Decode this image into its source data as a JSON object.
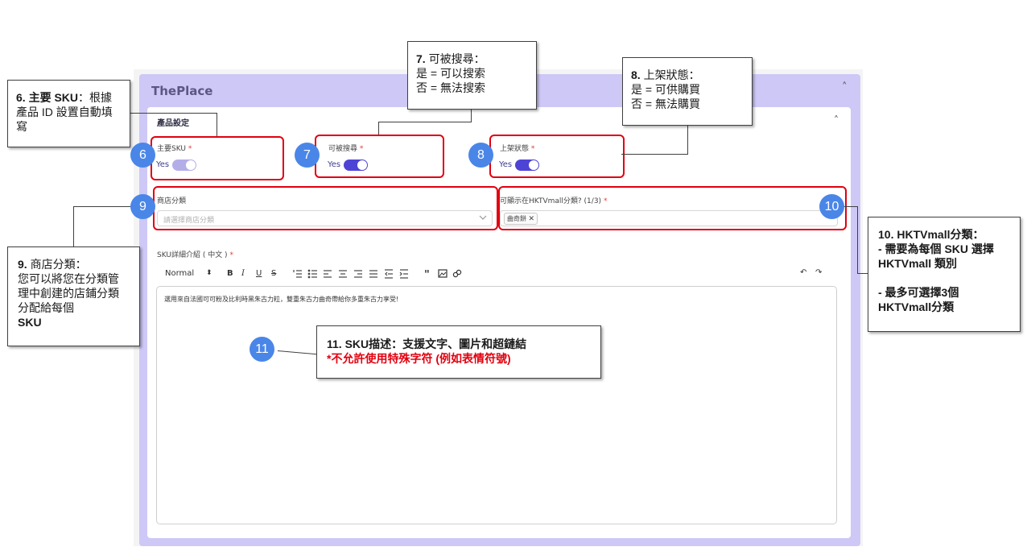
{
  "panel": {
    "title": "ThePlace",
    "chevron": "˄"
  },
  "section": {
    "title": "產品設定",
    "chevron": "˄"
  },
  "fields": {
    "main_sku": {
      "label": "主要SKU",
      "req": "*",
      "value": "Yes"
    },
    "searchable": {
      "label": "可被搜尋",
      "req": "*",
      "value": "Yes"
    },
    "online_status": {
      "label": "上架狀態",
      "req": "*",
      "value": "Yes"
    },
    "store_category": {
      "label": "商店分類",
      "placeholder": "請選擇商店分類"
    },
    "hktv_category": {
      "label": "可顯示在HKTVmall分類? (1/3)",
      "req": "*",
      "chip": "曲奇餅"
    },
    "sku_desc": {
      "label": "SKU詳細介紹 ( 中文 )",
      "req": "*",
      "content": "選用來自法國可可粉及比利時黑朱古力粒，雙重朱古力曲奇帶給你多重朱古力享受!"
    }
  },
  "toolbar": {
    "format": "Normal",
    "format_arrows": "⬍",
    "bold": "B",
    "italic": "I",
    "underline": "U",
    "strike": "S",
    "undo": "↶",
    "redo": "↷"
  },
  "markers": [
    "6",
    "7",
    "8",
    "9",
    "10",
    "11"
  ],
  "callouts": {
    "c6": {
      "num": "6.",
      "title": "主要 SKU",
      "rest": "：根據產品 ID 設置自動填寫"
    },
    "c7": {
      "line1_num": "7.",
      "line1": "可被搜尋：",
      "line2": "是 = 可以搜索",
      "line3": "否 = 無法搜索"
    },
    "c8": {
      "line1_num": "8.",
      "line1": "上架狀態：",
      "line2": "是 = 可供購買",
      "line3": "否 = 無法購買"
    },
    "c9": {
      "num": "9.",
      "title": "商店分類：",
      "body": "您可以將您在分類管理中創建的店鋪分類分配給每個",
      "tail": "SKU"
    },
    "c10": {
      "num": "10.",
      "title": "HKTVmall分類：",
      "line2": "- 需要為每個 SKU 選擇 HKTVmall 類別",
      "line3": "- 最多可選擇3個 HKTVmall分類"
    },
    "c11": {
      "num": "11.",
      "title": "SKU描述：支援文字、圖片和超鏈結",
      "warning": "*不允許使用特殊字符 (例如表情符號)"
    }
  },
  "colors": {
    "accent": "#4d44d6",
    "panel": "#cec8f7",
    "highlight": "#e2000f",
    "marker": "#4a86e8"
  }
}
